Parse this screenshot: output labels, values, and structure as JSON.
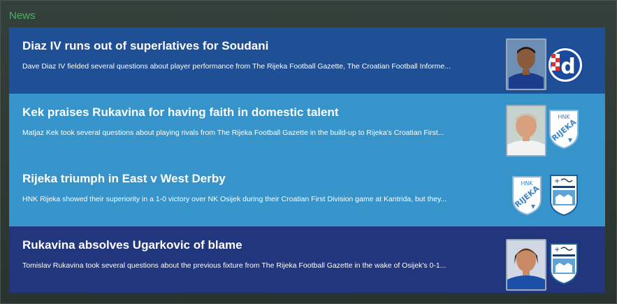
{
  "panel": {
    "title": "News"
  },
  "items": [
    {
      "headline": "Diaz IV runs out of superlatives for Soudani",
      "summary": "Dave Diaz IV fielded several questions about player performance from The Rijeka Football Gazette, The Croatian Football Informe...",
      "bg": "#1f4f94",
      "thumbs": [
        "player-portrait",
        "dinamo-zagreb-crest"
      ]
    },
    {
      "headline": "Kek praises Rukavina for having faith in domestic talent",
      "summary": "Matjaz Kek took several questions about playing rivals from The Rijeka Football Gazette in the build-up to Rijeka's Croatian First...",
      "bg": "#3694cb",
      "thumbs": [
        "manager-portrait",
        "hnk-rijeka-crest"
      ]
    },
    {
      "headline": "Rijeka triumph in East v West Derby",
      "summary": "HNK Rijeka showed their superiority in a 1-0 victory over NK Osijek during their Croatian First Division game at Kantrida, but they...",
      "bg": "#3694cb",
      "thumbs": [
        "hnk-rijeka-crest",
        "nk-osijek-crest"
      ]
    },
    {
      "headline": "Rukavina absolves Ugarkovic of blame",
      "summary": "Tomislav Rukavina took several questions about the previous fixture from The Rijeka Football Gazette in the wake of Osijek's 0-1...",
      "bg": "#22367e",
      "thumbs": [
        "player-portrait",
        "nk-osijek-crest"
      ]
    }
  ]
}
